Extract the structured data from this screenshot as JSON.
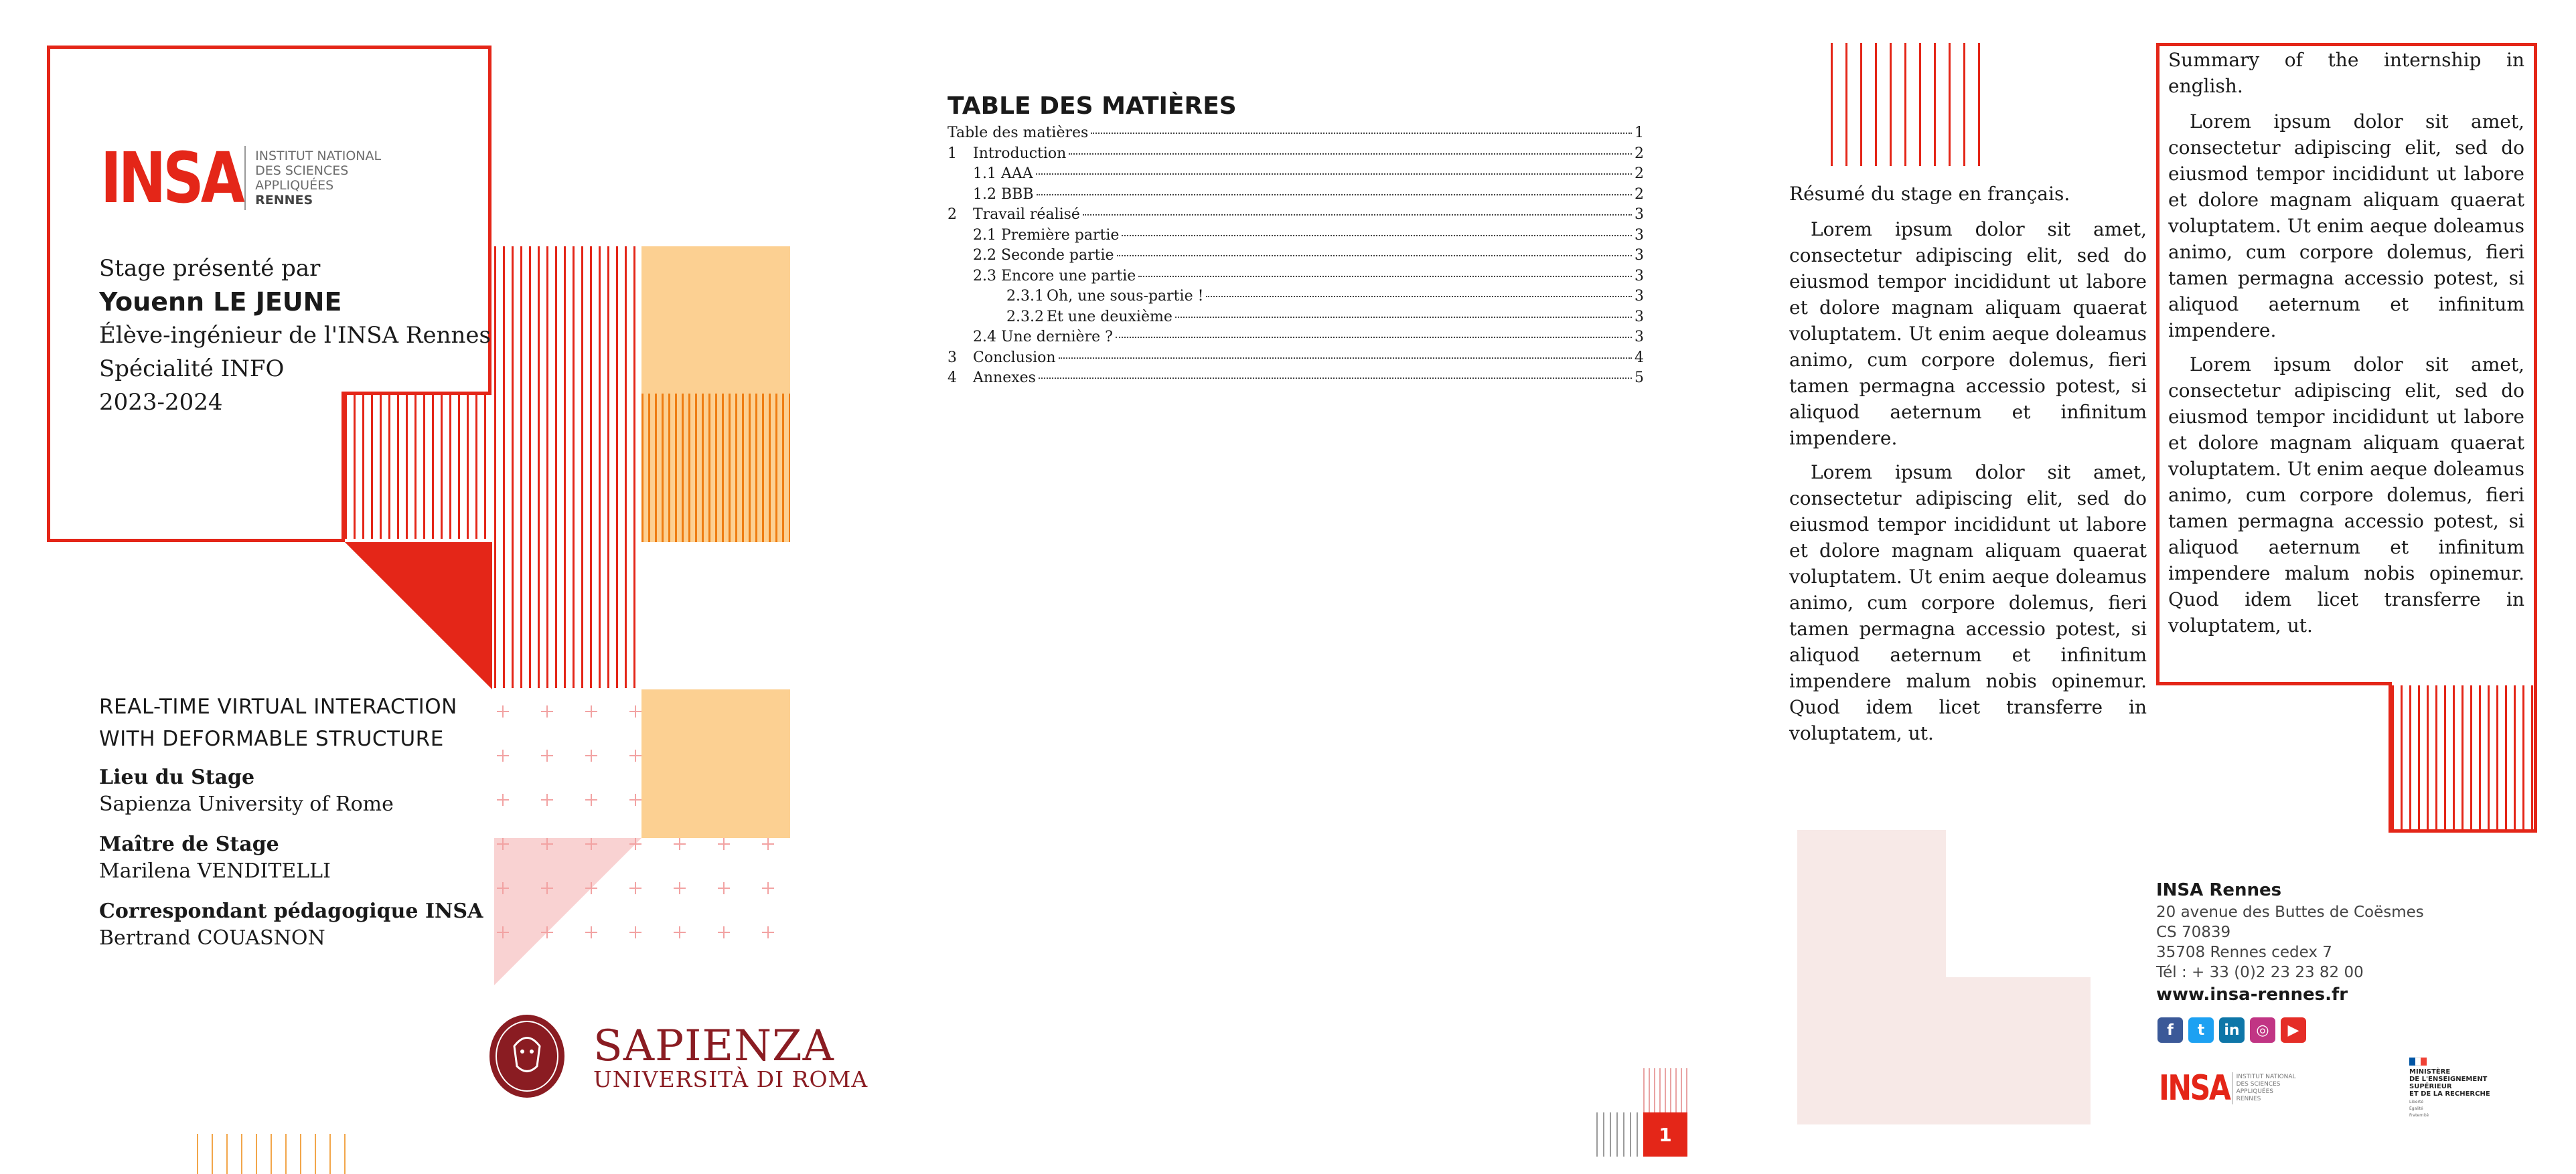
{
  "cover": {
    "logo": {
      "word": "INSA",
      "line1": "INSTITUT NATIONAL",
      "line2": "DES SCIENCES",
      "line3": "APPLIQUÉES",
      "line4": "RENNES"
    },
    "presented_by": "Stage présenté par",
    "student_name": "Youenn LE JEUNE",
    "role": "Élève-ingénieur de l'INSA Rennes",
    "speciality": "Spécialité INFO",
    "year": "2023-2024",
    "project_title_line1": "REAL-TIME VIRTUAL INTERACTION",
    "project_title_line2": "WITH DEFORMABLE STRUCTURE",
    "location_label": "Lieu du Stage",
    "location_value": "Sapienza University of Rome",
    "supervisor_label": "Maître de Stage",
    "supervisor_value": "Marilena VENDITELLI",
    "correspondent_label": "Correspondant pédagogique INSA",
    "correspondent_value": "Bertrand COUASNON",
    "partner_logo": {
      "big": "SAPIENZA",
      "small": "UNIVERSITÀ DI ROMA",
      "seal_text": "STUDIUM URBIS"
    }
  },
  "toc": {
    "title": "TABLE DES MATIÈRES",
    "entries": [
      {
        "num": "",
        "label": "Table des matières",
        "page": "1",
        "level": 0
      },
      {
        "num": "1",
        "label": "Introduction",
        "page": "2",
        "level": 1
      },
      {
        "num": "1.1",
        "label": "AAA",
        "page": "2",
        "level": 2
      },
      {
        "num": "1.2",
        "label": "BBB",
        "page": "2",
        "level": 2
      },
      {
        "num": "2",
        "label": "Travail réalisé",
        "page": "3",
        "level": 1
      },
      {
        "num": "2.1",
        "label": "Première partie",
        "page": "3",
        "level": 2
      },
      {
        "num": "2.2",
        "label": "Seconde partie",
        "page": "3",
        "level": 2
      },
      {
        "num": "2.3",
        "label": "Encore une partie",
        "page": "3",
        "level": 2
      },
      {
        "num": "2.3.1",
        "label": "Oh, une sous-partie !",
        "page": "3",
        "level": 3
      },
      {
        "num": "2.3.2",
        "label": "Et une deuxième",
        "page": "3",
        "level": 3
      },
      {
        "num": "2.4",
        "label": "Une dernière ?",
        "page": "3",
        "level": 2
      },
      {
        "num": "3",
        "label": "Conclusion",
        "page": "4",
        "level": 1
      },
      {
        "num": "4",
        "label": "Annexes",
        "page": "5",
        "level": 1
      }
    ],
    "page_number": "1"
  },
  "back": {
    "resume_lead": "Résumé du stage en français.",
    "resume_p1": "Lorem ipsum dolor sit amet, consectetur adipiscing elit, sed do eiusmod tempor incididunt ut labore et dolore magnam aliquam quaerat voluptatem. Ut enim aeque doleamus animo, cum corpore dolemus, fieri tamen permagna accessio potest, si aliquod aeternum et infinitum impendere.",
    "resume_p2": "Lorem ipsum dolor sit amet, consectetur adipiscing elit, sed do eiusmod tempor incididunt ut labore et dolore magnam aliquam quaerat voluptatem. Ut enim aeque doleamus animo, cum corpore dolemus, fieri tamen permagna accessio potest, si aliquod aeternum et infinitum impendere malum nobis opinemur. Quod idem licet transferre in voluptatem, ut.",
    "summary_lead": "Summary of the internship in english.",
    "summary_p1": "Lorem ipsum dolor sit amet, consectetur adipiscing elit, sed do eiusmod tempor incididunt ut labore et dolore magnam aliquam quaerat voluptatem. Ut enim aeque doleamus animo, cum corpore dolemus, fieri tamen permagna accessio potest, si aliquod aeternum et infinitum impendere.",
    "summary_p2": "Lorem ipsum dolor sit amet, consectetur adipiscing elit, sed do eiusmod tempor incididunt ut labore et dolore magnam aliquam quaerat voluptatem. Ut enim aeque doleamus animo, cum corpore dolemus, fieri tamen permagna accessio potest, si aliquod aeternum et infinitum impendere malum nobis opinemur. Quod idem licet transferre in voluptatem, ut.",
    "contact": {
      "org": "INSA Rennes",
      "address1": "20 avenue des Buttes de Coësmes",
      "address2": "CS 70839",
      "address3": "35708 Rennes cedex 7",
      "phone": "Tél : + 33 (0)2 23 23 82 00",
      "website": "www.insa-rennes.fr"
    },
    "socials": [
      {
        "icon": "facebook-icon",
        "glyph": "f",
        "color": "#3b5998"
      },
      {
        "icon": "twitter-icon",
        "glyph": "t",
        "color": "#1da1f2"
      },
      {
        "icon": "linkedin-icon",
        "glyph": "in",
        "color": "#0e76a8"
      },
      {
        "icon": "instagram-icon",
        "glyph": "◎",
        "color": "#c13584"
      },
      {
        "icon": "youtube-icon",
        "glyph": "▶",
        "color": "#e52d27"
      }
    ],
    "ministry": {
      "line1": "MINISTÈRE",
      "line2": "DE L'ENSEIGNEMENT",
      "line3": "SUPÉRIEUR",
      "line4": "ET DE LA RECHERCHE",
      "motto1": "Liberté",
      "motto2": "Égalité",
      "motto3": "Fraternité"
    }
  },
  "colors": {
    "brand_red": "#e42618",
    "orange": "#ef7d12",
    "peach": "#fcd092",
    "pink": "#f9d2d2",
    "sapienza_red": "#8a1c22"
  }
}
